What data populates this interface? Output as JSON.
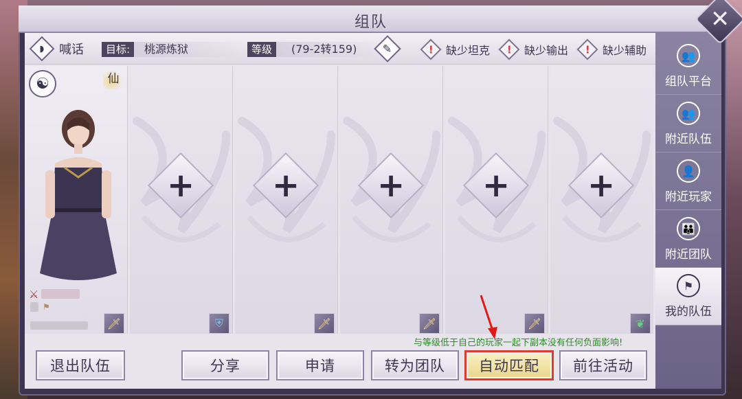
{
  "window": {
    "title": "组队",
    "close_icon": "close-icon"
  },
  "topbar": {
    "shout_label": "喊话",
    "target_tag": "目标:",
    "target_value": "桃源炼狱",
    "level_tag": "等级",
    "level_value": "(79-2转159)",
    "lacks": [
      "缺少坦克",
      "缺少输出",
      "缺少辅助"
    ]
  },
  "player": {
    "badge": "仙"
  },
  "notice": "与等级低于自己的玩家一起下副本没有任何负面影响!",
  "buttons": {
    "leave": "退出队伍",
    "share": "分享",
    "apply": "申请",
    "convert": "转为团队",
    "auto_match": "自动匹配",
    "goto_activity": "前往活动"
  },
  "sidebar": {
    "items": [
      {
        "label": "组队平台",
        "icon": "team-platform-icon"
      },
      {
        "label": "附近队伍",
        "icon": "nearby-team-icon"
      },
      {
        "label": "附近玩家",
        "icon": "nearby-player-icon"
      },
      {
        "label": "附近团队",
        "icon": "nearby-group-icon"
      },
      {
        "label": "我的队伍",
        "icon": "my-team-icon",
        "active": true
      }
    ]
  },
  "slots": [
    {
      "role_icon": "sword-icon"
    },
    {
      "role_icon": "shield-icon"
    },
    {
      "role_icon": "sword-icon"
    },
    {
      "role_icon": "sword-icon"
    },
    {
      "role_icon": "sword-icon"
    },
    {
      "role_icon": "leaf-icon"
    }
  ],
  "colors": {
    "accent": "#4b4560",
    "notice": "#2f8a2a",
    "highlight_border": "#e23a2a",
    "warn": "#e03a3a"
  }
}
